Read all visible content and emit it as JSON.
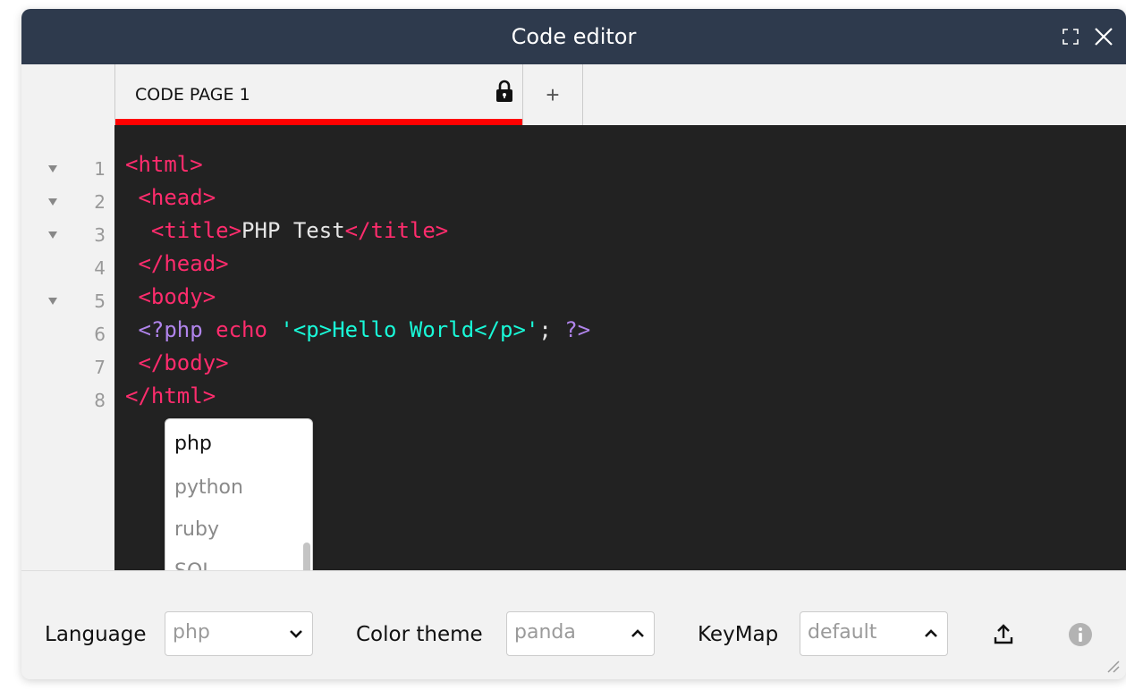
{
  "window": {
    "title": "Code editor"
  },
  "tabs": [
    {
      "label": "CODE PAGE 1",
      "locked": true,
      "active": true
    }
  ],
  "add_tab": {
    "label": "+"
  },
  "gutter": [
    {
      "num": "1",
      "fold": true
    },
    {
      "num": "2",
      "fold": true
    },
    {
      "num": "3",
      "fold": true
    },
    {
      "num": "4",
      "fold": false
    },
    {
      "num": "5",
      "fold": true
    },
    {
      "num": "6",
      "fold": false
    },
    {
      "num": "7",
      "fold": false
    },
    {
      "num": "8",
      "fold": false
    }
  ],
  "code": [
    [
      {
        "t": "<html>",
        "c": "tag"
      }
    ],
    [
      {
        "t": " <head>",
        "c": "tag"
      }
    ],
    [
      {
        "t": "  <title>",
        "c": "tag"
      },
      {
        "t": "PHP Test",
        "c": "txt"
      },
      {
        "t": "</title>",
        "c": "tag"
      }
    ],
    [
      {
        "t": " </head>",
        "c": "tag"
      }
    ],
    [
      {
        "t": " <body>",
        "c": "tag"
      }
    ],
    [
      {
        "t": " <?php",
        "c": "php"
      },
      {
        "t": " echo ",
        "c": "tag"
      },
      {
        "t": "'<p>Hello World</p>'",
        "c": "str"
      },
      {
        "t": "; ",
        "c": "txt"
      },
      {
        "t": "?>",
        "c": "php"
      }
    ],
    [
      {
        "t": " </body>",
        "c": "tag"
      }
    ],
    [
      {
        "t": "</html>",
        "c": "tag"
      }
    ]
  ],
  "code_colors": {
    "tag": "#ff2c6d",
    "txt": "#e6e6e6",
    "php": "#b084eb",
    "str": "#19f9d8",
    "background": "#222222"
  },
  "language_dropdown": {
    "options": [
      "php",
      "python",
      "ruby",
      "SQL"
    ],
    "selected": "php"
  },
  "footer": {
    "language_label": "Language",
    "language_value": "php",
    "color_theme_label": "Color theme",
    "color_theme_value": "panda",
    "keymap_label": "KeyMap",
    "keymap_value": "default"
  },
  "icons": {
    "expand": "expand-icon",
    "close": "close-icon",
    "lock": "lock-icon",
    "upload": "upload-icon",
    "info": "info-icon",
    "resize": "resize-grip-icon"
  },
  "colors": {
    "titlebar": "#2e3a4d",
    "active_tab_underline": "#ff0000"
  }
}
